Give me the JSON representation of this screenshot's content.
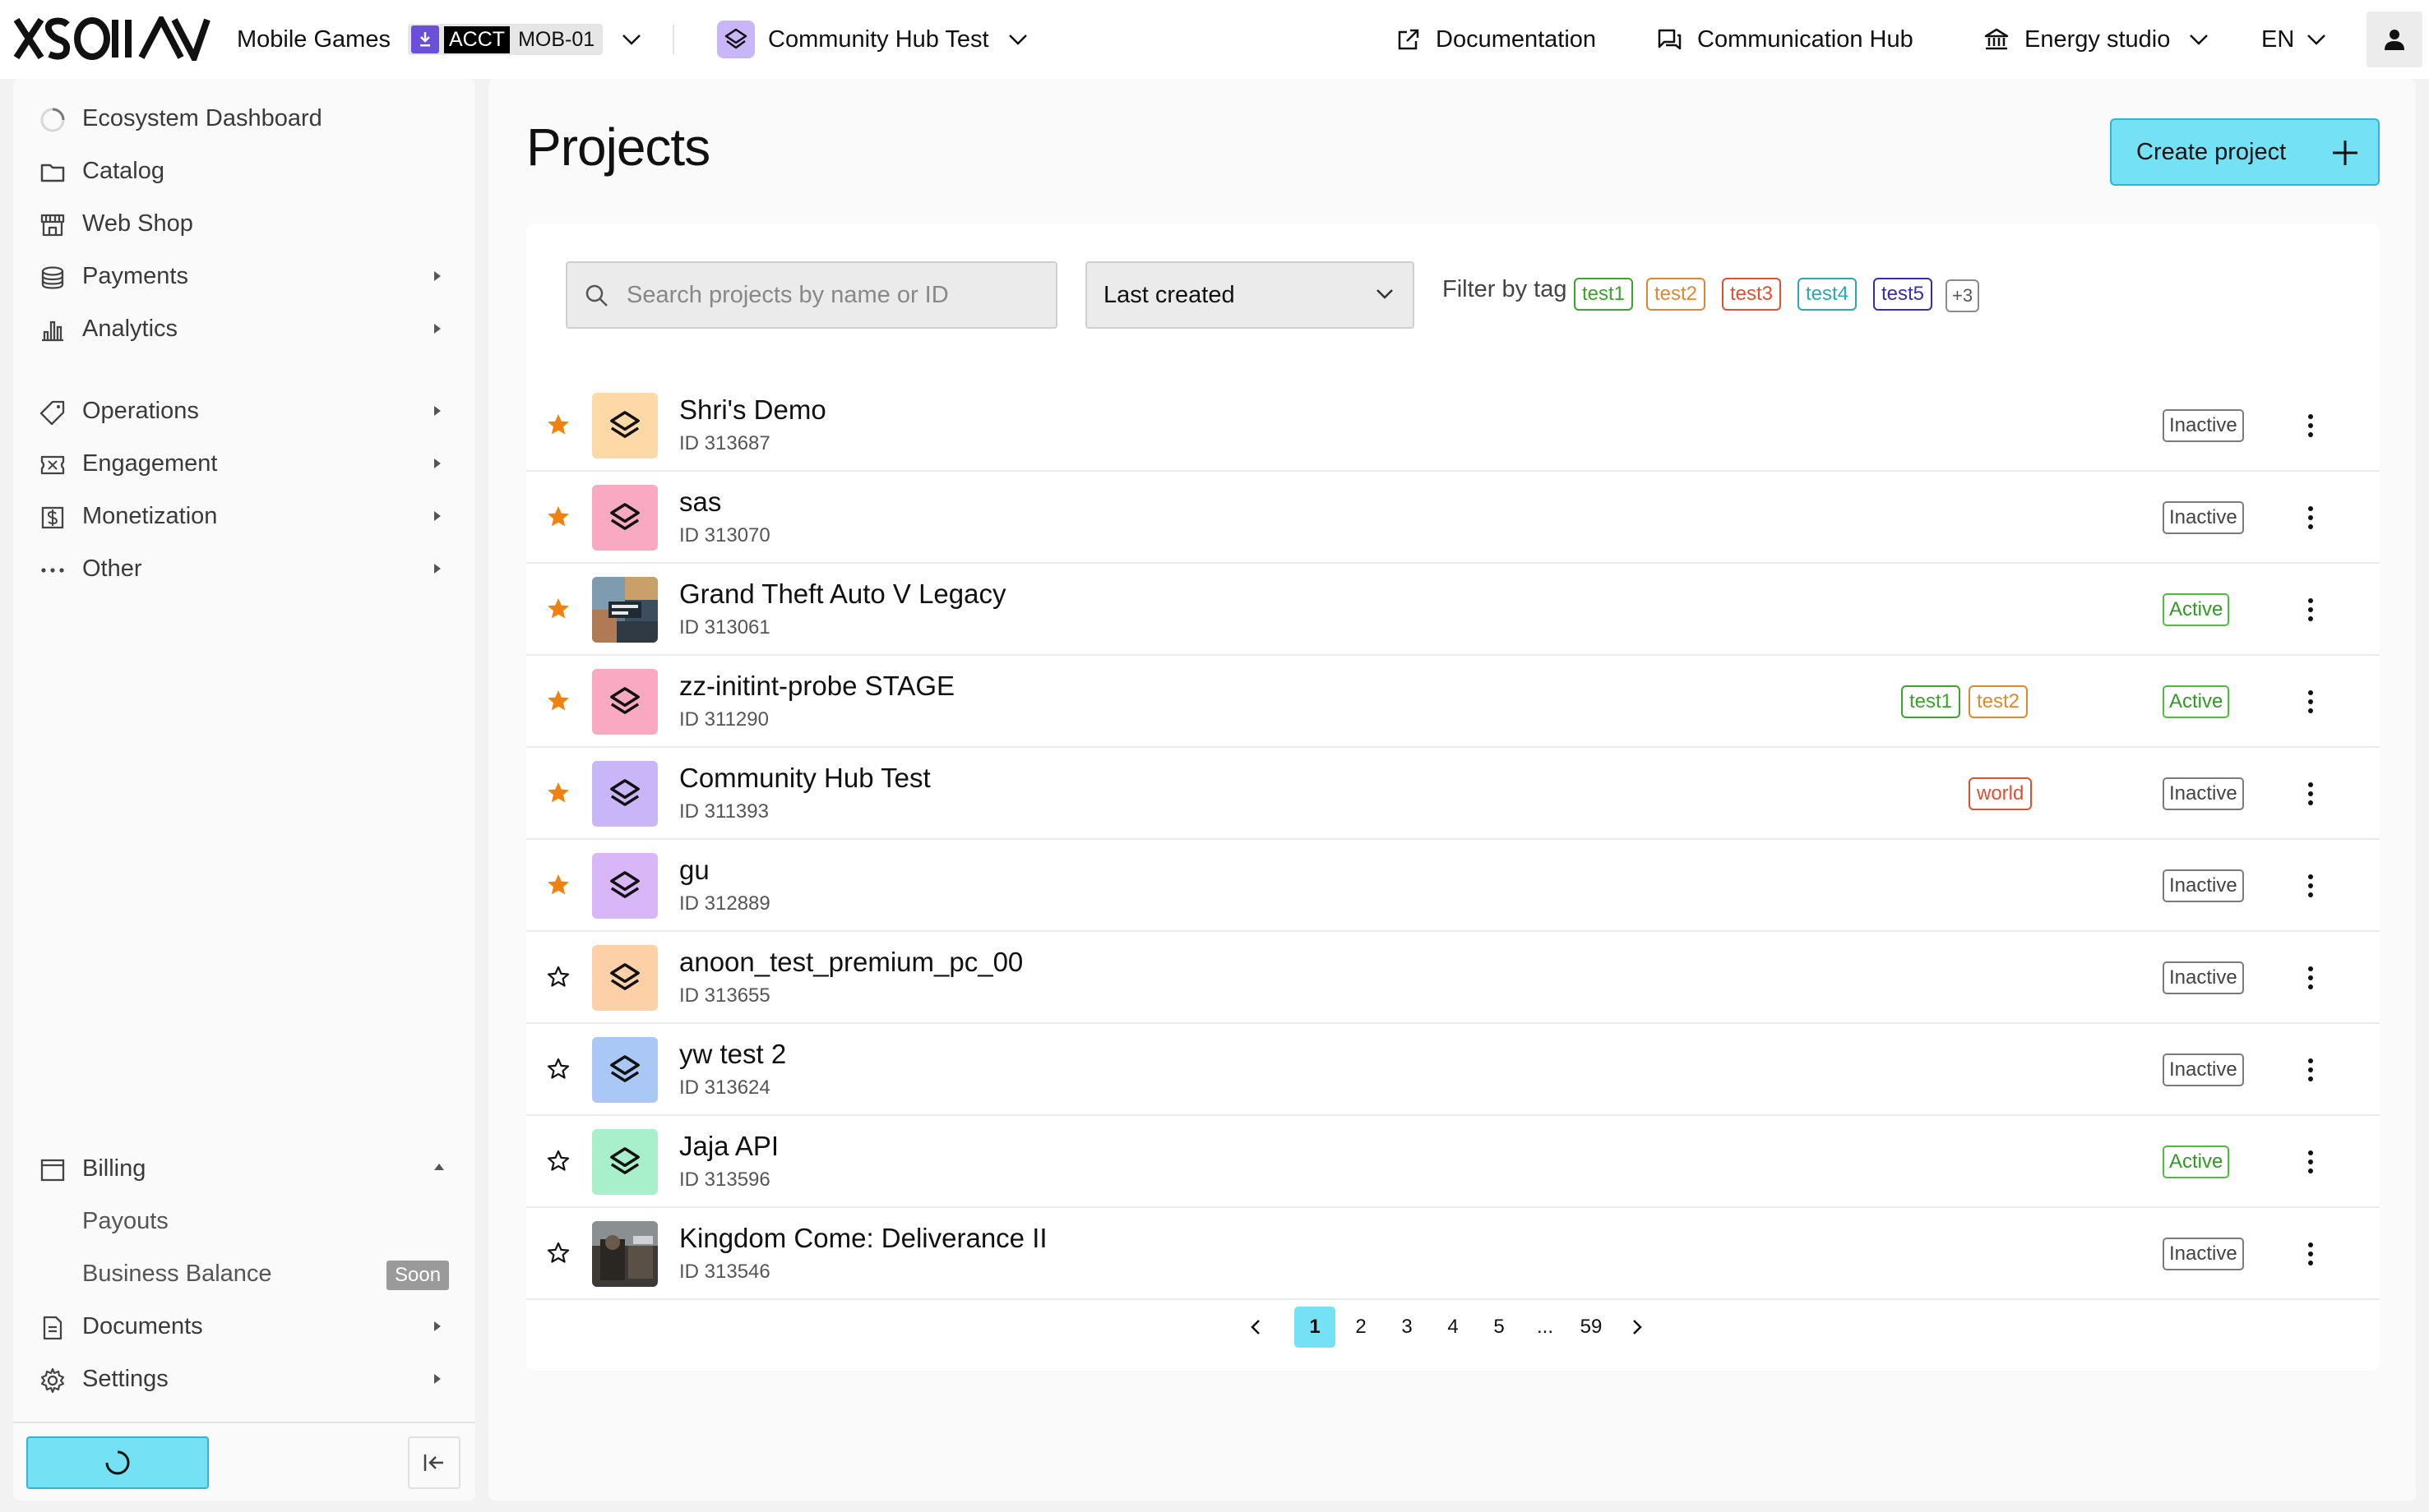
{
  "topbar": {
    "brand": "XSOLLA",
    "company": "Mobile Games",
    "acct_tag": "ACCT",
    "acct_id": "MOB-01",
    "project": "Community Hub Test",
    "documentation": "Documentation",
    "communication_hub": "Communication Hub",
    "studio": "Energy studio",
    "language": "EN"
  },
  "sidebar": {
    "items": [
      {
        "label": "Ecosystem Dashboard",
        "icon": "dashboard-spinner-icon"
      },
      {
        "label": "Catalog",
        "icon": "folder-icon"
      },
      {
        "label": "Web Shop",
        "icon": "store-icon"
      },
      {
        "label": "Payments",
        "icon": "coins-icon"
      },
      {
        "label": "Analytics",
        "icon": "bar-chart-icon"
      },
      {
        "label": "Operations",
        "icon": "tag-icon"
      },
      {
        "label": "Engagement",
        "icon": "ticket-icon"
      },
      {
        "label": "Monetization",
        "icon": "dollar-icon"
      },
      {
        "label": "Other",
        "icon": "more-dots-icon"
      }
    ],
    "billing": "Billing",
    "payouts": "Payouts",
    "business_balance": "Business Balance",
    "soon": "Soon",
    "documents": "Documents",
    "settings": "Settings"
  },
  "main": {
    "title": "Projects",
    "create_label": "Create project",
    "search_placeholder": "Search projects by name or ID",
    "sort_value": "Last created",
    "filter_label": "Filter by tag",
    "tags": [
      "test1",
      "test2",
      "test3",
      "test4",
      "test5"
    ],
    "tags_more": "+3"
  },
  "colors": {
    "accent": "#75e1f5",
    "accent_border": "#2fb6d6",
    "star": "#f0820f",
    "active": "#2f9a22",
    "tag1": "#3aa52b",
    "tag2": "#e0882e",
    "tag3": "#e0502e",
    "tag4": "#2aa8b8",
    "tag5": "#3a2bb0"
  },
  "projects": [
    {
      "name": "Shri's Demo",
      "id": "ID 313687",
      "status": "Inactive",
      "favorite": true,
      "thumb": "#fdd9a8"
    },
    {
      "name": "sas",
      "id": "ID 313070",
      "status": "Inactive",
      "favorite": true,
      "thumb": "#f9a9c2"
    },
    {
      "name": "Grand Theft Auto V Legacy",
      "id": "ID 313061",
      "status": "Active",
      "favorite": true,
      "thumb": "image"
    },
    {
      "name": "zz-initint-probe STAGE",
      "id": "ID 311290",
      "status": "Active",
      "favorite": true,
      "thumb": "#f9a9c2",
      "tags": [
        "test1",
        "test2"
      ]
    },
    {
      "name": "Community Hub Test",
      "id": "ID 311393",
      "status": "Inactive",
      "favorite": true,
      "thumb": "#c9b6f8",
      "tags": [
        "world"
      ]
    },
    {
      "name": "gu",
      "id": "ID 312889",
      "status": "Inactive",
      "favorite": true,
      "thumb": "#d9b6f8"
    },
    {
      "name": "anoon_test_premium_pc_00",
      "id": "ID 313655",
      "status": "Inactive",
      "favorite": false,
      "thumb": "#fdd0a8"
    },
    {
      "name": "yw test 2",
      "id": "ID 313624",
      "status": "Inactive",
      "favorite": false,
      "thumb": "#a9c8f5"
    },
    {
      "name": "Jaja API",
      "id": "ID 313596",
      "status": "Active",
      "favorite": false,
      "thumb": "#a8f0cc"
    },
    {
      "name": "Kingdom Come: Deliverance II",
      "id": "ID 313546",
      "status": "Inactive",
      "favorite": false,
      "thumb": "image"
    }
  ],
  "pagination": {
    "pages": [
      "1",
      "2",
      "3",
      "4",
      "5"
    ],
    "ellipsis": "...",
    "last": "59",
    "current": "1"
  }
}
